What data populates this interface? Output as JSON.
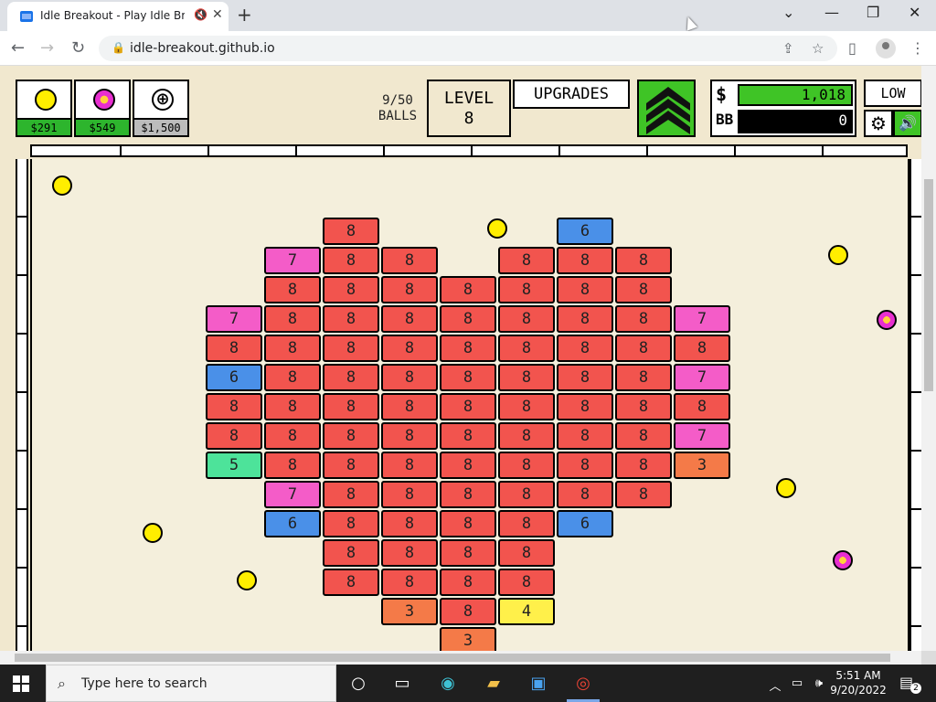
{
  "browser": {
    "tab_title": "Idle Breakout - Play Idle Brea",
    "url": "idle-breakout.github.io",
    "new_tab": "+",
    "mute_icon": "speaker-muted-icon",
    "close_tab": "✕"
  },
  "window": {
    "minimize": "—",
    "restore": "❐",
    "close": "✕",
    "chevron": "⌄"
  },
  "hud": {
    "ball_shop": [
      {
        "kind": "basic-ball",
        "color": "#ffee00",
        "price": "$291"
      },
      {
        "kind": "plasma-ball",
        "color": "#e82fd0",
        "price": "$549"
      },
      {
        "kind": "add-ball",
        "symbol": "⊕",
        "price": "$1,500"
      }
    ],
    "balls_count": "9/50",
    "balls_label": "BALLS",
    "level_label": "LEVEL",
    "level_value": "8",
    "upgrades_label": "UPGRADES",
    "money_symbol": "$",
    "money_value": "1,018",
    "bb_label": "BB",
    "bb_value": "0",
    "quality_label": "LOW"
  },
  "colors": {
    "brick_red": "#f2544e",
    "brick_pink": "#f45cc8",
    "brick_blue": "#4a90e8",
    "brick_green": "#4de39a",
    "brick_orange": "#f47a48",
    "brick_yellow": "#fff04a",
    "ball_yellow": "#ffee00",
    "ball_plasma": "#e82fd0",
    "accent_green": "#3fc426"
  },
  "bricks": [
    {
      "col": 5,
      "row": 0,
      "v": "8",
      "c": "red"
    },
    {
      "col": 9,
      "row": 0,
      "v": "6",
      "c": "blue"
    },
    {
      "col": 4,
      "row": 1,
      "v": "7",
      "c": "pink"
    },
    {
      "col": 5,
      "row": 1,
      "v": "8",
      "c": "red"
    },
    {
      "col": 6,
      "row": 1,
      "v": "8",
      "c": "red"
    },
    {
      "col": 8,
      "row": 1,
      "v": "8",
      "c": "red"
    },
    {
      "col": 9,
      "row": 1,
      "v": "8",
      "c": "red"
    },
    {
      "col": 10,
      "row": 1,
      "v": "8",
      "c": "red"
    },
    {
      "col": 4,
      "row": 2,
      "v": "8",
      "c": "red"
    },
    {
      "col": 5,
      "row": 2,
      "v": "8",
      "c": "red"
    },
    {
      "col": 6,
      "row": 2,
      "v": "8",
      "c": "red"
    },
    {
      "col": 7,
      "row": 2,
      "v": "8",
      "c": "red"
    },
    {
      "col": 8,
      "row": 2,
      "v": "8",
      "c": "red"
    },
    {
      "col": 9,
      "row": 2,
      "v": "8",
      "c": "red"
    },
    {
      "col": 10,
      "row": 2,
      "v": "8",
      "c": "red"
    },
    {
      "col": 3,
      "row": 3,
      "v": "7",
      "c": "pink"
    },
    {
      "col": 4,
      "row": 3,
      "v": "8",
      "c": "red"
    },
    {
      "col": 5,
      "row": 3,
      "v": "8",
      "c": "red"
    },
    {
      "col": 6,
      "row": 3,
      "v": "8",
      "c": "red"
    },
    {
      "col": 7,
      "row": 3,
      "v": "8",
      "c": "red"
    },
    {
      "col": 8,
      "row": 3,
      "v": "8",
      "c": "red"
    },
    {
      "col": 9,
      "row": 3,
      "v": "8",
      "c": "red"
    },
    {
      "col": 10,
      "row": 3,
      "v": "8",
      "c": "red"
    },
    {
      "col": 11,
      "row": 3,
      "v": "7",
      "c": "pink"
    },
    {
      "col": 3,
      "row": 4,
      "v": "8",
      "c": "red"
    },
    {
      "col": 4,
      "row": 4,
      "v": "8",
      "c": "red"
    },
    {
      "col": 5,
      "row": 4,
      "v": "8",
      "c": "red"
    },
    {
      "col": 6,
      "row": 4,
      "v": "8",
      "c": "red"
    },
    {
      "col": 7,
      "row": 4,
      "v": "8",
      "c": "red"
    },
    {
      "col": 8,
      "row": 4,
      "v": "8",
      "c": "red"
    },
    {
      "col": 9,
      "row": 4,
      "v": "8",
      "c": "red"
    },
    {
      "col": 10,
      "row": 4,
      "v": "8",
      "c": "red"
    },
    {
      "col": 11,
      "row": 4,
      "v": "8",
      "c": "red"
    },
    {
      "col": 3,
      "row": 5,
      "v": "6",
      "c": "blue"
    },
    {
      "col": 4,
      "row": 5,
      "v": "8",
      "c": "red"
    },
    {
      "col": 5,
      "row": 5,
      "v": "8",
      "c": "red"
    },
    {
      "col": 6,
      "row": 5,
      "v": "8",
      "c": "red"
    },
    {
      "col": 7,
      "row": 5,
      "v": "8",
      "c": "red"
    },
    {
      "col": 8,
      "row": 5,
      "v": "8",
      "c": "red"
    },
    {
      "col": 9,
      "row": 5,
      "v": "8",
      "c": "red"
    },
    {
      "col": 10,
      "row": 5,
      "v": "8",
      "c": "red"
    },
    {
      "col": 11,
      "row": 5,
      "v": "7",
      "c": "pink"
    },
    {
      "col": 3,
      "row": 6,
      "v": "8",
      "c": "red"
    },
    {
      "col": 4,
      "row": 6,
      "v": "8",
      "c": "red"
    },
    {
      "col": 5,
      "row": 6,
      "v": "8",
      "c": "red"
    },
    {
      "col": 6,
      "row": 6,
      "v": "8",
      "c": "red"
    },
    {
      "col": 7,
      "row": 6,
      "v": "8",
      "c": "red"
    },
    {
      "col": 8,
      "row": 6,
      "v": "8",
      "c": "red"
    },
    {
      "col": 9,
      "row": 6,
      "v": "8",
      "c": "red"
    },
    {
      "col": 10,
      "row": 6,
      "v": "8",
      "c": "red"
    },
    {
      "col": 11,
      "row": 6,
      "v": "8",
      "c": "red"
    },
    {
      "col": 3,
      "row": 7,
      "v": "8",
      "c": "red"
    },
    {
      "col": 4,
      "row": 7,
      "v": "8",
      "c": "red"
    },
    {
      "col": 5,
      "row": 7,
      "v": "8",
      "c": "red"
    },
    {
      "col": 6,
      "row": 7,
      "v": "8",
      "c": "red"
    },
    {
      "col": 7,
      "row": 7,
      "v": "8",
      "c": "red"
    },
    {
      "col": 8,
      "row": 7,
      "v": "8",
      "c": "red"
    },
    {
      "col": 9,
      "row": 7,
      "v": "8",
      "c": "red"
    },
    {
      "col": 10,
      "row": 7,
      "v": "8",
      "c": "red"
    },
    {
      "col": 11,
      "row": 7,
      "v": "7",
      "c": "pink"
    },
    {
      "col": 3,
      "row": 8,
      "v": "5",
      "c": "green"
    },
    {
      "col": 4,
      "row": 8,
      "v": "8",
      "c": "red"
    },
    {
      "col": 5,
      "row": 8,
      "v": "8",
      "c": "red"
    },
    {
      "col": 6,
      "row": 8,
      "v": "8",
      "c": "red"
    },
    {
      "col": 7,
      "row": 8,
      "v": "8",
      "c": "red"
    },
    {
      "col": 8,
      "row": 8,
      "v": "8",
      "c": "red"
    },
    {
      "col": 9,
      "row": 8,
      "v": "8",
      "c": "red"
    },
    {
      "col": 10,
      "row": 8,
      "v": "8",
      "c": "red"
    },
    {
      "col": 11,
      "row": 8,
      "v": "3",
      "c": "orange"
    },
    {
      "col": 4,
      "row": 9,
      "v": "7",
      "c": "pink"
    },
    {
      "col": 5,
      "row": 9,
      "v": "8",
      "c": "red"
    },
    {
      "col": 6,
      "row": 9,
      "v": "8",
      "c": "red"
    },
    {
      "col": 7,
      "row": 9,
      "v": "8",
      "c": "red"
    },
    {
      "col": 8,
      "row": 9,
      "v": "8",
      "c": "red"
    },
    {
      "col": 9,
      "row": 9,
      "v": "8",
      "c": "red"
    },
    {
      "col": 10,
      "row": 9,
      "v": "8",
      "c": "red"
    },
    {
      "col": 4,
      "row": 10,
      "v": "6",
      "c": "blue"
    },
    {
      "col": 5,
      "row": 10,
      "v": "8",
      "c": "red"
    },
    {
      "col": 6,
      "row": 10,
      "v": "8",
      "c": "red"
    },
    {
      "col": 7,
      "row": 10,
      "v": "8",
      "c": "red"
    },
    {
      "col": 8,
      "row": 10,
      "v": "8",
      "c": "red"
    },
    {
      "col": 9,
      "row": 10,
      "v": "6",
      "c": "blue"
    },
    {
      "col": 5,
      "row": 11,
      "v": "8",
      "c": "red"
    },
    {
      "col": 6,
      "row": 11,
      "v": "8",
      "c": "red"
    },
    {
      "col": 7,
      "row": 11,
      "v": "8",
      "c": "red"
    },
    {
      "col": 8,
      "row": 11,
      "v": "8",
      "c": "red"
    },
    {
      "col": 5,
      "row": 12,
      "v": "8",
      "c": "red"
    },
    {
      "col": 6,
      "row": 12,
      "v": "8",
      "c": "red"
    },
    {
      "col": 7,
      "row": 12,
      "v": "8",
      "c": "red"
    },
    {
      "col": 8,
      "row": 12,
      "v": "8",
      "c": "red"
    },
    {
      "col": 6,
      "row": 13,
      "v": "3",
      "c": "orange"
    },
    {
      "col": 7,
      "row": 13,
      "v": "8",
      "c": "red"
    },
    {
      "col": 8,
      "row": 13,
      "v": "4",
      "c": "yellow"
    },
    {
      "col": 7,
      "row": 14,
      "v": "3",
      "c": "orange"
    }
  ],
  "taskbar": {
    "search_placeholder": "Type here to search",
    "time": "5:51 AM",
    "date": "9/20/2022",
    "notification_count": "2"
  }
}
